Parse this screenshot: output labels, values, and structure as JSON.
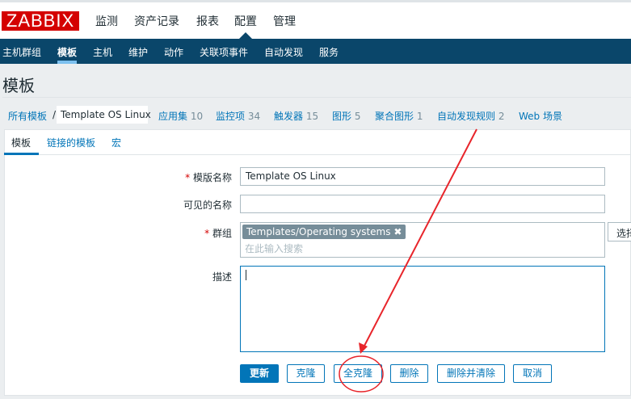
{
  "logo": "ZABBIX",
  "top_menu": [
    "监测",
    "资产记录",
    "报表",
    "配置",
    "管理"
  ],
  "sub_menu": [
    "主机群组",
    "模板",
    "主机",
    "维护",
    "动作",
    "关联项事件",
    "自动发现",
    "服务"
  ],
  "page_title": "模板",
  "breadcrumb": {
    "root": "所有模板",
    "sep": "/",
    "current": "Template OS Linux"
  },
  "links": [
    {
      "label": "应用集",
      "count": "10"
    },
    {
      "label": "监控项",
      "count": "34"
    },
    {
      "label": "触发器",
      "count": "15"
    },
    {
      "label": "图形",
      "count": "5"
    },
    {
      "label": "聚合图形",
      "count": "1"
    },
    {
      "label": "自动发现规则",
      "count": "2"
    },
    {
      "label": "Web 场景",
      "count": ""
    }
  ],
  "tabs": [
    "模板",
    "链接的模板",
    "宏"
  ],
  "form": {
    "template_name_label": "模版名称",
    "template_name": "Template OS Linux",
    "visible_name_label": "可见的名称",
    "visible_name": "",
    "groups_label": "群组",
    "group_tag": "Templates/Operating systems",
    "group_placeholder": "在此输入搜索",
    "select_button": "选择",
    "description_label": "描述",
    "description": "",
    "required_mark": "*"
  },
  "buttons": [
    "更新",
    "克隆",
    "全克隆",
    "删除",
    "删除并清除",
    "取消"
  ],
  "colors": {
    "brand": "#d40000",
    "nav": "#0a466a",
    "accent": "#0275b8",
    "annotation": "#e8252b"
  }
}
